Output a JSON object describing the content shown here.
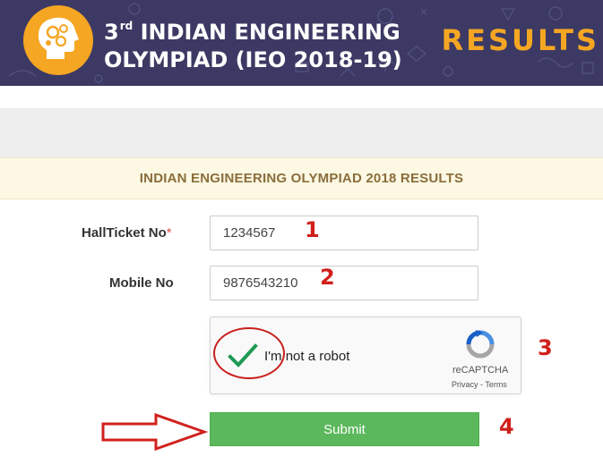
{
  "banner": {
    "ordinal_number": "3",
    "ordinal_suffix": "rd",
    "title_line1": "INDIAN ENGINEERING",
    "title_line2": "OLYMPIAD (IEO 2018-19)",
    "results_word": "RESULTS",
    "background_color": "#3c3a64",
    "accent_color": "#f5a623"
  },
  "heading": "INDIAN ENGINEERING OLYMPIAD 2018 RESULTS",
  "form": {
    "hallticket_label": "HallTicket No",
    "required_mark": "*",
    "hallticket_value": "1234567",
    "mobile_label": "Mobile No",
    "mobile_value": "9876543210",
    "submit_label": "Submit"
  },
  "recaptcha": {
    "checkbox_label": "I'm not a robot",
    "brand": "reCAPTCHA",
    "privacy": "Privacy",
    "separator": " - ",
    "terms": "Terms",
    "checked": true
  },
  "annotations": {
    "step1": "1",
    "step2": "2",
    "step3": "3",
    "step4": "4",
    "annotation_color": "#d0211c"
  }
}
